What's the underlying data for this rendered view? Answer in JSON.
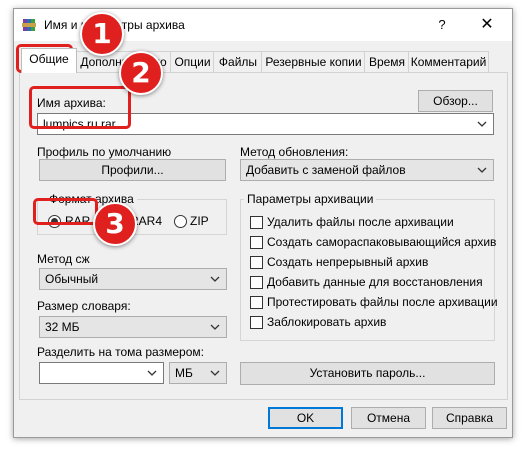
{
  "window": {
    "title": "Имя и параметры архива",
    "help_glyph": "?",
    "close_glyph": "✕"
  },
  "tabs": [
    {
      "label": "Общие",
      "active": true
    },
    {
      "label": "Дополнительно",
      "active": false
    },
    {
      "label": "Опции",
      "active": false
    },
    {
      "label": "Файлы",
      "active": false
    },
    {
      "label": "Резервные копии",
      "active": false
    },
    {
      "label": "Время",
      "active": false
    },
    {
      "label": "Комментарий",
      "active": false
    }
  ],
  "archive_name": {
    "label": "Имя архива:",
    "value": "lumpics.ru.rar",
    "browse_button": "Обзор..."
  },
  "profile": {
    "label": "Профиль по умолчанию",
    "button": "Профили..."
  },
  "update_method": {
    "label": "Метод обновления:",
    "value": "Добавить с заменой файлов"
  },
  "archive_format": {
    "group_title": "Формат архива",
    "options": [
      {
        "label": "RAR",
        "checked": true
      },
      {
        "label": "RAR4",
        "checked": false
      },
      {
        "label": "ZIP",
        "checked": false
      }
    ]
  },
  "compression": {
    "label": "Метод сж",
    "value": "Обычный"
  },
  "dictionary": {
    "label": "Размер словаря:",
    "value": "32 МБ"
  },
  "split": {
    "label": "Разделить на тома размером:",
    "value": "",
    "unit": "МБ"
  },
  "archive_options": {
    "group_title": "Параметры архивации",
    "items": [
      {
        "label": "Удалить файлы после архивации",
        "checked": false
      },
      {
        "label": "Создать самораспаковывающийся архив",
        "checked": false
      },
      {
        "label": "Создать непрерывный архив",
        "checked": false
      },
      {
        "label": "Добавить данные для восстановления",
        "checked": false
      },
      {
        "label": "Протестировать файлы после архивации",
        "checked": false
      },
      {
        "label": "Заблокировать архив",
        "checked": false
      }
    ]
  },
  "set_password_button": "Установить пароль...",
  "footer": {
    "ok": "OK",
    "cancel": "Отмена",
    "help": "Справка"
  },
  "badges": [
    "1",
    "2",
    "3"
  ],
  "colors": {
    "highlight_red": "#e0201e",
    "default_button_border": "#0078d7"
  }
}
